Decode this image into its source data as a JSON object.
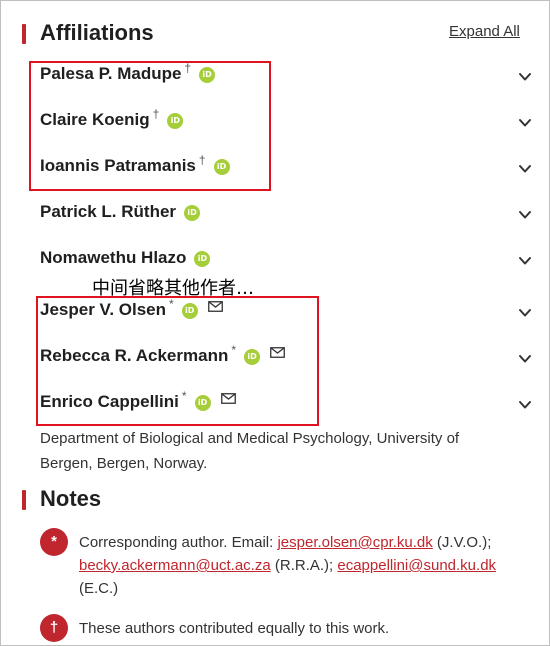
{
  "affiliations": {
    "title": "Affiliations",
    "expand_all": "Expand All",
    "authors": [
      {
        "name": "Palesa P. Madupe",
        "mark": "†",
        "orcid": true,
        "mail": false
      },
      {
        "name": "Claire Koenig",
        "mark": "†",
        "orcid": true,
        "mail": false
      },
      {
        "name": "Ioannis Patramanis",
        "mark": "†",
        "orcid": true,
        "mail": false
      },
      {
        "name": "Patrick L. Rüther",
        "mark": "",
        "orcid": true,
        "mail": false
      },
      {
        "name": "Nomawethu Hlazo",
        "mark": "",
        "orcid": true,
        "mail": false
      },
      {
        "name": "Jesper V. Olsen",
        "mark": "*",
        "orcid": true,
        "mail": true
      },
      {
        "name": "Rebecca R. Ackermann",
        "mark": "*",
        "orcid": true,
        "mail": true
      },
      {
        "name": "Enrico Cappellini",
        "mark": "*",
        "orcid": true,
        "mail": true
      }
    ],
    "omitted_note": "中间省略其他作者…",
    "expanded_affiliation": "Department of Biological and Medical Psychology, University of Bergen, Bergen, Norway."
  },
  "notes": {
    "title": "Notes",
    "items": [
      {
        "badge": "*",
        "prefix": "Corresponding author. Email: ",
        "email1": "jesper.olsen@cpr.ku.dk",
        "after1": " (J.V.O.); ",
        "email2": "becky.ackermann@uct.ac.za",
        "after2": " (R.R.A.); ",
        "email3": "ecappellini@sund.ku.dk",
        "after3": " (E.C.)"
      },
      {
        "badge": "†",
        "text": "These authors contributed equally to this work."
      }
    ]
  },
  "colors": {
    "accent": "#c0262d",
    "orcid": "#a6ce39",
    "highlight_box": "#e0141e"
  }
}
